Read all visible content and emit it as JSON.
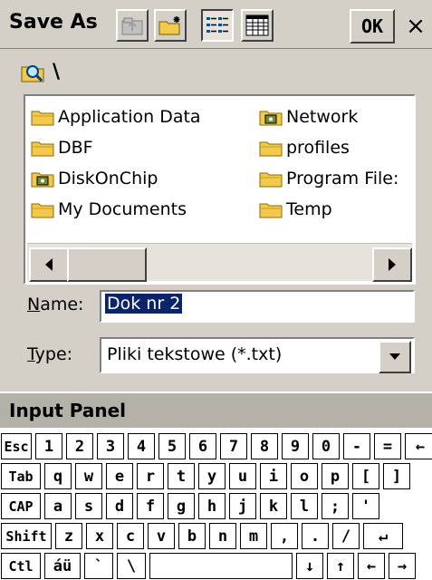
{
  "title": "Save As",
  "toolbar": {
    "ok_label": "OK",
    "close_label": "×"
  },
  "path": {
    "text": "\\"
  },
  "files": [
    {
      "name": "Application Data",
      "icon": "folder-icon"
    },
    {
      "name": "DBF",
      "icon": "folder-icon"
    },
    {
      "name": "DiskOnChip",
      "icon": "storage-folder-icon"
    },
    {
      "name": "My Documents",
      "icon": "folder-icon"
    },
    {
      "name": "Network",
      "icon": "network-folder-icon"
    },
    {
      "name": "profiles",
      "icon": "folder-icon"
    },
    {
      "name": "Program File:",
      "icon": "folder-icon"
    },
    {
      "name": "Temp",
      "icon": "folder-icon"
    }
  ],
  "name_field": {
    "label_prefix": "N",
    "label_rest": "ame:",
    "value": "Dok nr 2"
  },
  "type_field": {
    "label_prefix": "T",
    "label_rest": "ype:",
    "value": "Pliki tekstowe (*.txt)"
  },
  "input_panel": {
    "title": "Input Panel"
  },
  "keyboard_rows": [
    [
      "Esc",
      "1",
      "2",
      "3",
      "4",
      "5",
      "6",
      "7",
      "8",
      "9",
      "0",
      "-",
      "=",
      "←"
    ],
    [
      "Tab",
      "q",
      "w",
      "e",
      "r",
      "t",
      "y",
      "u",
      "i",
      "o",
      "p",
      "[",
      "]"
    ],
    [
      "CAP",
      "a",
      "s",
      "d",
      "f",
      "g",
      "h",
      "j",
      "k",
      "l",
      ";",
      "'"
    ],
    [
      "Shift",
      "z",
      "x",
      "c",
      "v",
      "b",
      "n",
      "m",
      ",",
      ".",
      "/",
      "↵"
    ],
    [
      "Ctl",
      "áü",
      "`",
      "\\",
      " ",
      "↓",
      "↑",
      "←",
      "→"
    ]
  ],
  "colors": {
    "selection": "#0a246a",
    "folder": "#f2c94c",
    "chrome": "#d4d0c8"
  }
}
